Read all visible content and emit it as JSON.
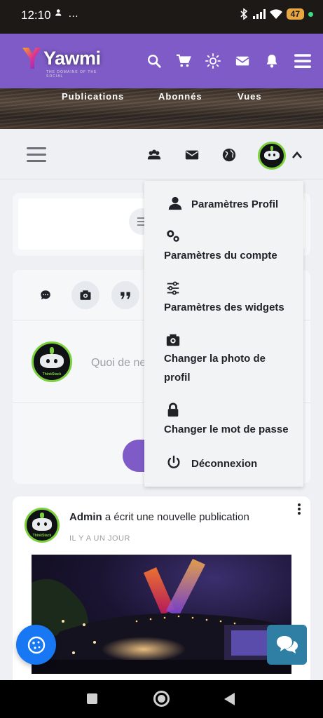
{
  "status_bar": {
    "time": "12:10",
    "left_icons": "…",
    "battery": "47"
  },
  "header": {
    "brand": "Yawmi",
    "tagline": "THE DOMAINE OF THE SOCIAL"
  },
  "cover": {
    "stats": [
      "Publications",
      "Abonnés",
      "Vues"
    ]
  },
  "composer": {
    "placeholder": "Quoi de ne"
  },
  "feed": {
    "author": "Admin",
    "action": " a écrit une nouvelle publication",
    "time": "IL Y A UN JOUR"
  },
  "dropdown": {
    "items": [
      {
        "label": "Paramètres Profil",
        "icon": "user-icon"
      },
      {
        "label": "Paramètres du compte",
        "icon": "cogs-icon"
      },
      {
        "label": "Paramètres des widgets",
        "icon": "sliders-icon"
      },
      {
        "label": "Changer la photo de profil",
        "icon": "camera-icon"
      },
      {
        "label": "Changer le mot de passe",
        "icon": "lock-icon"
      },
      {
        "label": "Déconnexion",
        "icon": "power-icon"
      }
    ]
  },
  "colors": {
    "brand": "#7e5bc6",
    "fab": "#1877f2",
    "chat": "#2e7fa3",
    "avatar_ring": "#7ad13b"
  }
}
